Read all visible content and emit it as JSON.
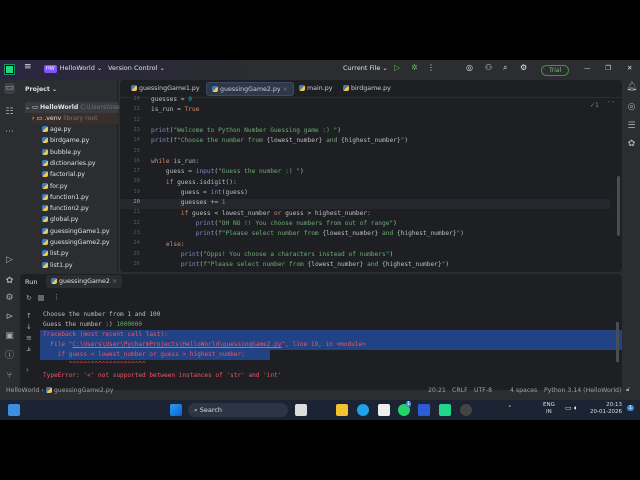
{
  "titlebar": {
    "project": "HelloWorld",
    "project_badge": "HW",
    "vcs": "Version Control",
    "run_config": "Current File",
    "trial": "Trial"
  },
  "project_panel": {
    "title": "Project",
    "root": "HelloWorld",
    "root_path": "C:\\Users\\Use",
    "venv": ".venv",
    "venv_note": "library root",
    "files": [
      "age.py",
      "birdgame.py",
      "bubble.py",
      "dictionaries.py",
      "factorial.py",
      "for.py",
      "function1.py",
      "function2.py",
      "global.py",
      "guessingGame1.py",
      "guessingGame2.py",
      "list.py",
      "list1.py"
    ]
  },
  "editor": {
    "tabs": [
      "guessingGame1.py",
      "guessingGame2.py",
      "main.py",
      "birdgame.py"
    ],
    "active_tab": "guessingGame2.py",
    "inspection": "✓1",
    "line_numbers": [
      "10",
      "11",
      "12",
      "13",
      "14",
      "15",
      "16",
      "17",
      "18",
      "19",
      "20",
      "21",
      "22",
      "23",
      "24",
      "25",
      "26"
    ],
    "current_line": "20"
  },
  "run": {
    "title": "Run",
    "tab": "guessingGame2",
    "output": [
      "Choose the number from 1 and 100",
      "Guess the number :) ",
      "1000000",
      "Traceback (most recent call last):",
      "  File \"",
      "C:\\Users\\User\\PycharmProjects\\HelloWorld\\guessingGame2.py",
      "\", line 19, in <module>",
      "    if guess < lowest_number or guess > highest_number:",
      "       ^^^^^^^^^^^^^^^^^^^^^",
      "TypeError: '<' not supported between instances of 'str' and 'int'"
    ]
  },
  "status": {
    "breadcrumb_project": "HelloWorld",
    "breadcrumb_file": "guessingGame2.py",
    "position": "20:21",
    "line_sep": "CRLF",
    "encoding": "UTF-8",
    "indent": "4 spaces",
    "interpreter": "Python 3.14 (HelloWorld)"
  },
  "taskbar": {
    "search": "Search",
    "lang": "ENG",
    "region": "IN",
    "time": "20:13",
    "date": "20-01-2026",
    "notif": "1",
    "whatsapp_badge": "1"
  }
}
